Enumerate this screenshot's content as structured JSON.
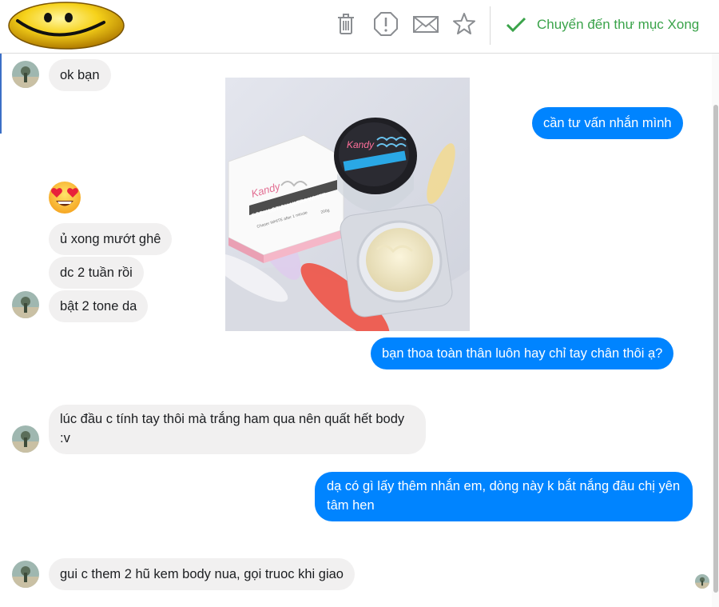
{
  "toolbar": {
    "icons": [
      "trash-icon",
      "report-icon",
      "mail-icon",
      "star-icon"
    ],
    "move_label": "Chuyển đến thư mục Xong",
    "accent": "#3aa34a"
  },
  "messages": [
    {
      "dir": "in",
      "text": "ok bạn"
    },
    {
      "dir": "out",
      "text": "cần tư vấn nhắn mình"
    },
    {
      "dir": "in",
      "text": "ủ xong mướt ghê"
    },
    {
      "dir": "in",
      "text": "dc 2 tuần rồi"
    },
    {
      "dir": "in",
      "text": "bật 2 tone da"
    },
    {
      "dir": "out",
      "text": "bạn thoa toàn thân luôn hay chỉ tay chân thôi ạ?"
    },
    {
      "dir": "in",
      "text": "lúc đầu c tính tay thôi mà trắng ham qua nên quất hết body :v"
    },
    {
      "dir": "out",
      "text": "dạ có gì lấy thêm nhắn em, dòng này k bắt nắng đâu chị yên tâm hen"
    },
    {
      "dir": "in",
      "text": "gui c them 2 hũ kem body nua, gọi truoc khi giao"
    }
  ],
  "photo": {
    "jar_brand": "Kandy",
    "box_label": "BODY LOTION ULTRA WHITE",
    "box_sub": "Chaser WHITE after 1 minute",
    "box_weight": "200g"
  },
  "colors": {
    "outgoing": "#0084ff",
    "incoming": "#f1f0f0"
  }
}
